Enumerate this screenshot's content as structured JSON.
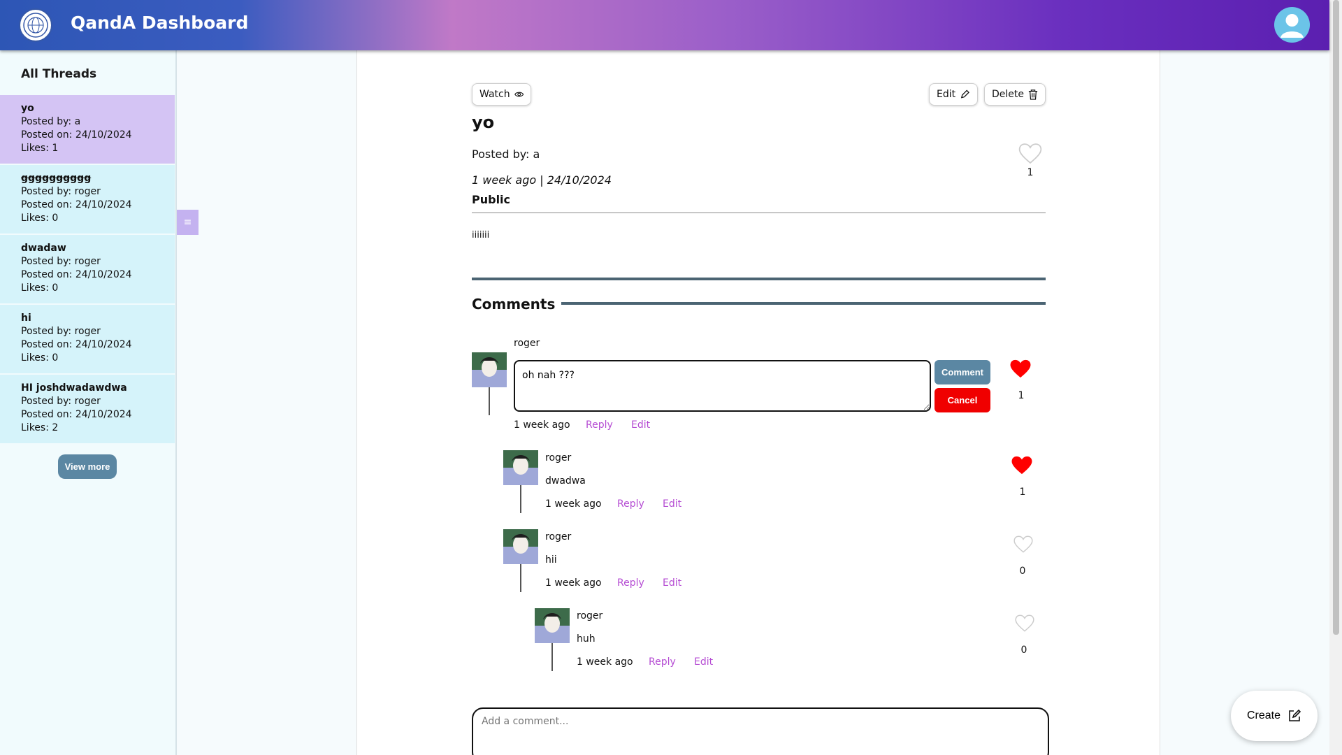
{
  "header": {
    "title": "QandA Dashboard"
  },
  "sidebar": {
    "heading": "All Threads",
    "threads": [
      {
        "title": "yo",
        "posted_by": "Posted by: a",
        "posted_on": "Posted on: 24/10/2024",
        "likes": "Likes: 1"
      },
      {
        "title": "gggggggggg",
        "posted_by": "Posted by: roger",
        "posted_on": "Posted on: 24/10/2024",
        "likes": "Likes: 0"
      },
      {
        "title": "dwadaw",
        "posted_by": "Posted by: roger",
        "posted_on": "Posted on: 24/10/2024",
        "likes": "Likes: 0"
      },
      {
        "title": "hi",
        "posted_by": "Posted by: roger",
        "posted_on": "Posted on: 24/10/2024",
        "likes": "Likes: 0"
      },
      {
        "title": "HI joshdwadawdwa",
        "posted_by": "Posted by: roger",
        "posted_on": "Posted on: 24/10/2024",
        "likes": "Likes: 2"
      }
    ],
    "view_more": "View more",
    "toggle_glyph": "≡"
  },
  "post": {
    "watch": "Watch",
    "edit": "Edit",
    "delete": "Delete",
    "title": "yo",
    "posted_by": "Posted by: a",
    "date": "1 week ago | 24/10/2024",
    "visibility": "Public",
    "body": "iiiiiii",
    "likes": "1"
  },
  "comments": {
    "heading": "Comments",
    "items": [
      {
        "user": "roger",
        "edit_value": "oh nah ???",
        "time": "1 week ago",
        "reply": "Reply",
        "edit": "Edit",
        "likes": "1",
        "comment_btn": "Comment",
        "cancel_btn": "Cancel"
      },
      {
        "user": "roger",
        "text": "dwadwa",
        "time": "1 week ago",
        "reply": "Reply",
        "edit": "Edit",
        "likes": "1"
      },
      {
        "user": "roger",
        "text": "hii",
        "time": "1 week ago",
        "reply": "Reply",
        "edit": "Edit",
        "likes": "0"
      },
      {
        "user": "roger",
        "text": "huh",
        "time": "1 week ago",
        "reply": "Reply",
        "edit": "Edit",
        "likes": "0"
      }
    ],
    "add_placeholder": "Add a comment..."
  },
  "create": {
    "label": "Create"
  },
  "colors": {
    "accent": "#5b87a3",
    "link": "#b54cd3",
    "heart": "#ff0000",
    "cancel": "#f00000"
  }
}
